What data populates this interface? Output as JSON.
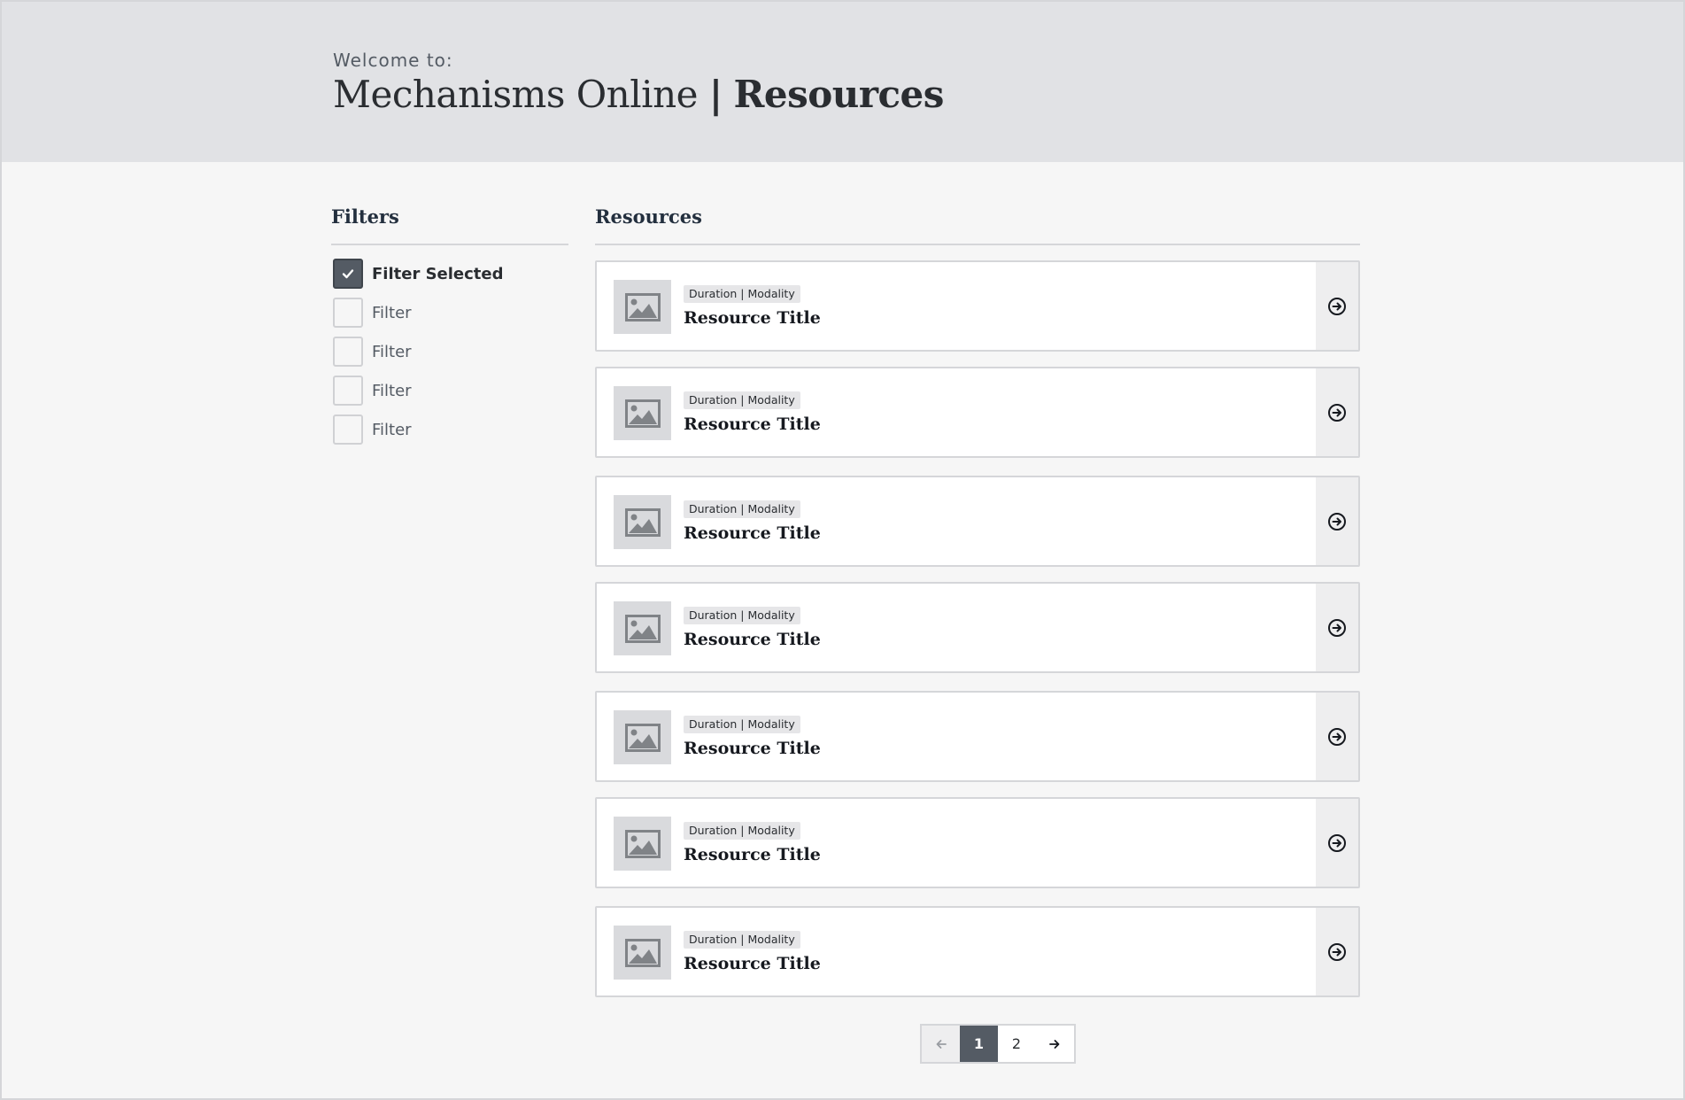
{
  "header": {
    "welcome": "Welcome to:",
    "site_name": "Mechanisms Online",
    "separator": "|",
    "section": "Resources"
  },
  "filters": {
    "heading": "Filters",
    "items": [
      {
        "label": "Filter Selected",
        "checked": true
      },
      {
        "label": "Filter",
        "checked": false
      },
      {
        "label": "Filter",
        "checked": false
      },
      {
        "label": "Filter",
        "checked": false
      },
      {
        "label": "Filter",
        "checked": false
      }
    ]
  },
  "resources": {
    "heading": "Resources",
    "items": [
      {
        "meta": "Duration | Modality",
        "title": "Resource Title",
        "thumbnail_icon": "image-placeholder-icon",
        "action_icon": "arrow-circle-right-icon"
      },
      {
        "meta": "Duration | Modality",
        "title": "Resource Title",
        "thumbnail_icon": "image-placeholder-icon",
        "action_icon": "arrow-circle-right-icon"
      },
      {
        "meta": "Duration | Modality",
        "title": "Resource Title",
        "thumbnail_icon": "image-placeholder-icon",
        "action_icon": "arrow-circle-right-icon"
      },
      {
        "meta": "Duration | Modality",
        "title": "Resource Title",
        "thumbnail_icon": "image-placeholder-icon",
        "action_icon": "arrow-circle-right-icon"
      },
      {
        "meta": "Duration | Modality",
        "title": "Resource Title",
        "thumbnail_icon": "image-placeholder-icon",
        "action_icon": "arrow-circle-right-icon"
      },
      {
        "meta": "Duration | Modality",
        "title": "Resource Title",
        "thumbnail_icon": "image-placeholder-icon",
        "action_icon": "arrow-circle-right-icon"
      },
      {
        "meta": "Duration | Modality",
        "title": "Resource Title",
        "thumbnail_icon": "image-placeholder-icon",
        "action_icon": "arrow-circle-right-icon"
      }
    ]
  },
  "pagination": {
    "prev_icon": "arrow-left-icon",
    "pages": [
      "1",
      "2"
    ],
    "current_page": "1",
    "next_icon": "arrow-right-icon"
  },
  "colors": {
    "header_bg": "#e1e2e5",
    "page_bg": "#f6f6f6",
    "accent_dark": "#545b64",
    "card_bg": "#ffffff",
    "border": "#d5d6d9"
  }
}
